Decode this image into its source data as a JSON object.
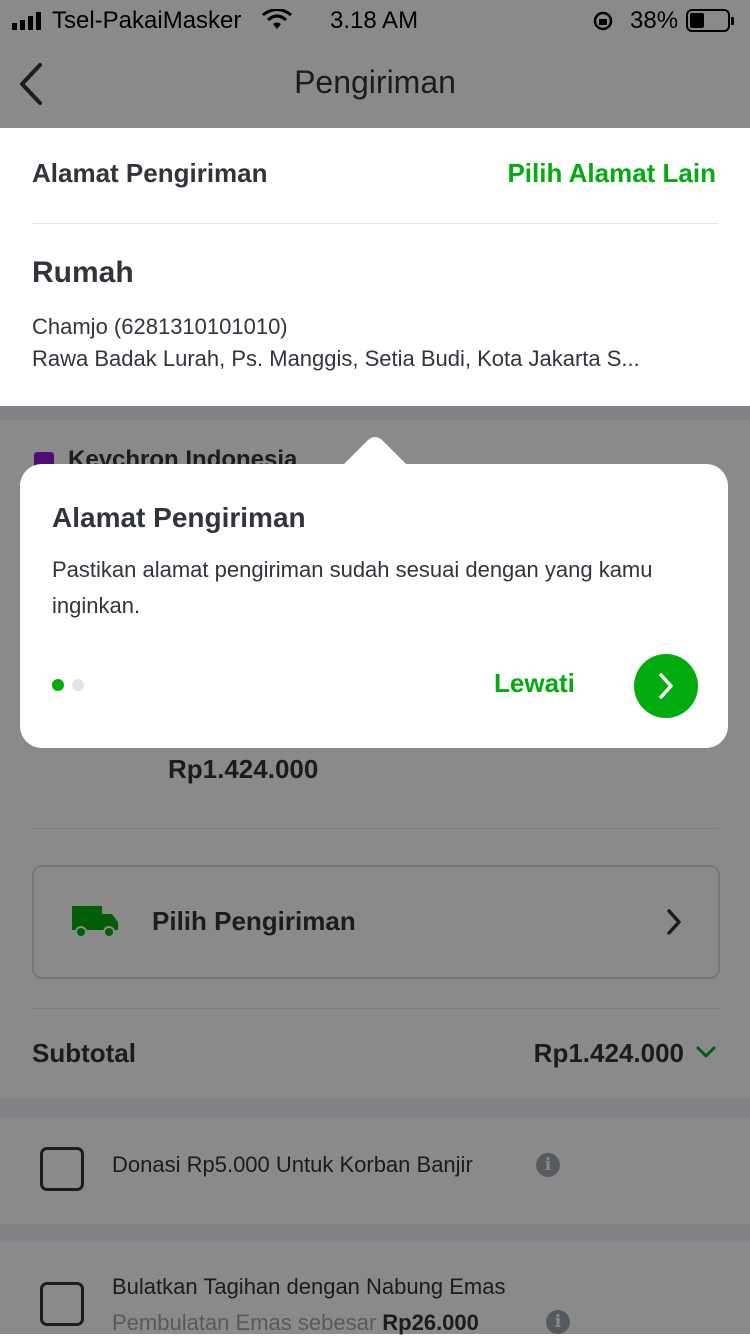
{
  "status_bar": {
    "carrier": "Tsel-PakaiMasker",
    "time": "3.18 AM",
    "battery": "38%"
  },
  "header": {
    "title": "Pengiriman"
  },
  "address": {
    "label": "Alamat Pengiriman",
    "change_label": "Pilih Alamat Lain",
    "name": "Rumah",
    "recipient": "Chamjo (6281310101010)",
    "line": "Rawa Badak Lurah, Ps. Manggis, Setia Budi, Kota Jakarta S..."
  },
  "shop": {
    "name": "Keychron Indonesia",
    "price": "Rp1.424.000"
  },
  "shipping": {
    "label": "Pilih Pengiriman"
  },
  "subtotal": {
    "label": "Subtotal",
    "value": "Rp1.424.000"
  },
  "donation": {
    "label": "Donasi Rp5.000 Untuk Korban Banjir"
  },
  "rounding": {
    "label": "Bulatkan Tagihan dengan Nabung Emas",
    "sub_prefix": "Pembulatan Emas sebesar",
    "sub_amount": "Rp26.000"
  },
  "coachmark": {
    "title": "Alamat Pengiriman",
    "body": "Pastikan alamat pengiriman sudah sesuai dengan yang kamu inginkan.",
    "skip_label": "Lewati",
    "step": 1,
    "total_steps": 2
  },
  "colors": {
    "accent": "#03ac0e",
    "text": "#31353b",
    "muted": "#9fa6b0"
  }
}
